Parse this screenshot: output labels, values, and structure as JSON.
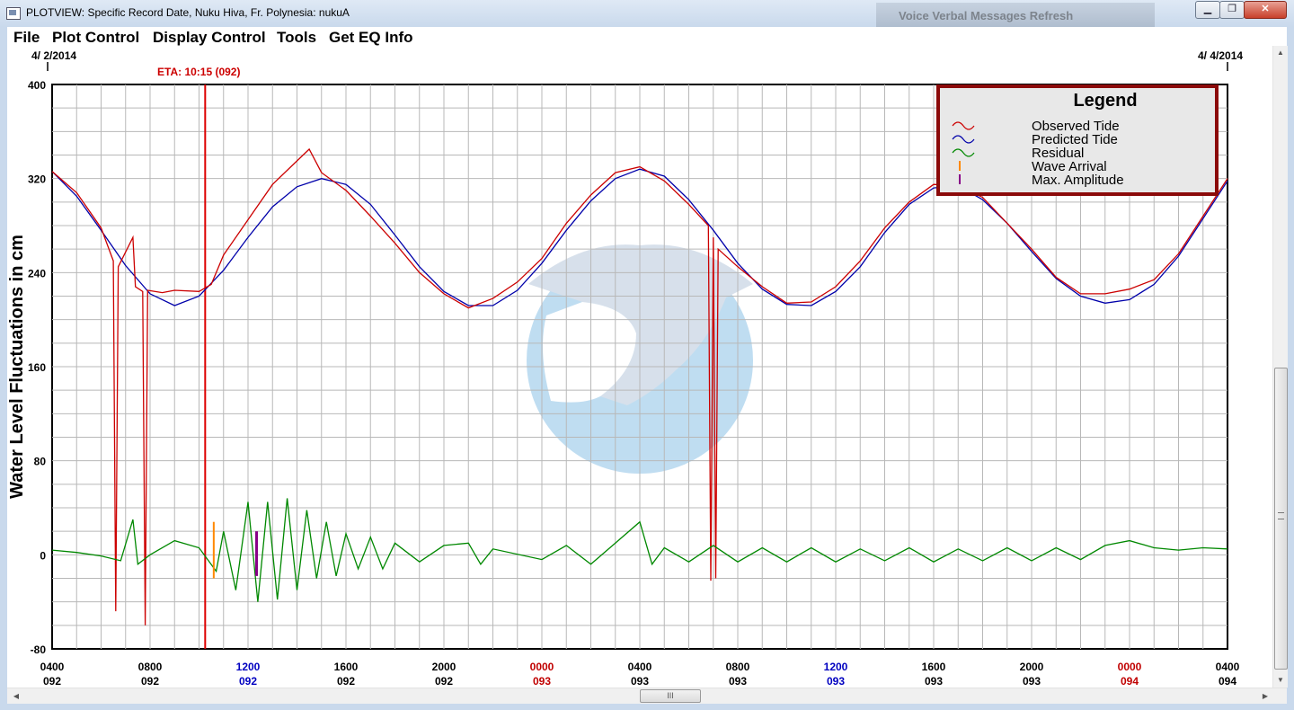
{
  "window": {
    "title": "PLOTVIEW: Specific Record Date, Nuku Hiva, Fr. Polynesia: nukuA",
    "background_window_text": "Voice   Verbal Messages   Refresh",
    "minimize_label": "▁",
    "maximize_label": "❐",
    "close_label": "✕"
  },
  "menu": [
    "File",
    "Plot Control",
    "Display Control",
    "Tools",
    "Get EQ Info"
  ],
  "scrollbars": {
    "up_arrow": "▲",
    "down_arrow": "▼",
    "left_arrow": "◀",
    "right_arrow": "▶",
    "grip": "III"
  },
  "chart_data": {
    "type": "line",
    "ylabel": "Water Level Fluctuations in cm",
    "ylim": [
      -80,
      400
    ],
    "yticks": [
      -80,
      0,
      80,
      160,
      240,
      320,
      400
    ],
    "date_labels": {
      "start": "4/ 2/2014",
      "end": "4/ 4/2014"
    },
    "eta_label": "ETA: 10:15 (092)",
    "eta_time_hours": 10.25,
    "xlim_hours": [
      4,
      52
    ],
    "xticks": [
      {
        "hours": 4,
        "time": "0400",
        "day": "092",
        "color": "#000000"
      },
      {
        "hours": 8,
        "time": "0800",
        "day": "092",
        "color": "#000000"
      },
      {
        "hours": 12,
        "time": "1200",
        "day": "092",
        "color": "#0000c0"
      },
      {
        "hours": 16,
        "time": "1600",
        "day": "092",
        "color": "#000000"
      },
      {
        "hours": 20,
        "time": "2000",
        "day": "092",
        "color": "#000000"
      },
      {
        "hours": 24,
        "time": "0000",
        "day": "093",
        "color": "#c00000"
      },
      {
        "hours": 28,
        "time": "0400",
        "day": "093",
        "color": "#000000"
      },
      {
        "hours": 32,
        "time": "0800",
        "day": "093",
        "color": "#000000"
      },
      {
        "hours": 36,
        "time": "1200",
        "day": "093",
        "color": "#0000c0"
      },
      {
        "hours": 40,
        "time": "1600",
        "day": "093",
        "color": "#000000"
      },
      {
        "hours": 44,
        "time": "2000",
        "day": "093",
        "color": "#000000"
      },
      {
        "hours": 48,
        "time": "0000",
        "day": "094",
        "color": "#c00000"
      },
      {
        "hours": 52,
        "time": "0400",
        "day": "094",
        "color": "#000000"
      }
    ],
    "legend": {
      "title": "Legend",
      "position": "top-right",
      "entries": [
        {
          "label": "Observed Tide",
          "color": "#cc0000",
          "symbol": "wave"
        },
        {
          "label": "Predicted Tide",
          "color": "#0000aa",
          "symbol": "wave"
        },
        {
          "label": "Residual",
          "color": "#008800",
          "symbol": "wave"
        },
        {
          "label": "Wave Arrival",
          "color": "#ff8800",
          "symbol": "tick"
        },
        {
          "label": "Max. Amplitude",
          "color": "#880088",
          "symbol": "tick"
        }
      ]
    },
    "series": [
      {
        "name": "Predicted Tide",
        "color": "#0000aa",
        "points": [
          [
            4,
            326
          ],
          [
            5,
            305
          ],
          [
            6,
            276
          ],
          [
            7,
            246
          ],
          [
            8,
            222
          ],
          [
            9,
            212
          ],
          [
            10,
            220
          ],
          [
            11,
            242
          ],
          [
            12,
            270
          ],
          [
            13,
            296
          ],
          [
            14,
            313
          ],
          [
            15,
            320
          ],
          [
            16,
            315
          ],
          [
            17,
            298
          ],
          [
            18,
            272
          ],
          [
            19,
            245
          ],
          [
            20,
            224
          ],
          [
            21,
            212
          ],
          [
            22,
            212
          ],
          [
            23,
            225
          ],
          [
            24,
            248
          ],
          [
            25,
            276
          ],
          [
            26,
            301
          ],
          [
            27,
            320
          ],
          [
            28,
            328
          ],
          [
            29,
            322
          ],
          [
            30,
            302
          ],
          [
            31,
            276
          ],
          [
            32,
            248
          ],
          [
            33,
            226
          ],
          [
            34,
            213
          ],
          [
            35,
            212
          ],
          [
            36,
            224
          ],
          [
            37,
            245
          ],
          [
            38,
            274
          ],
          [
            39,
            298
          ],
          [
            40,
            312
          ],
          [
            41,
            314
          ],
          [
            42,
            302
          ],
          [
            43,
            282
          ],
          [
            44,
            258
          ],
          [
            45,
            235
          ],
          [
            46,
            220
          ],
          [
            47,
            214
          ],
          [
            48,
            217
          ],
          [
            49,
            230
          ],
          [
            50,
            254
          ],
          [
            51,
            286
          ],
          [
            52,
            318
          ]
        ]
      },
      {
        "name": "Observed Tide",
        "color": "#cc0000",
        "points": [
          [
            4,
            326
          ],
          [
            5,
            308
          ],
          [
            6,
            278
          ],
          [
            6.5,
            250
          ],
          [
            6.6,
            -48
          ],
          [
            6.7,
            245
          ],
          [
            7.3,
            270
          ],
          [
            7.4,
            228
          ],
          [
            7.7,
            224
          ],
          [
            7.8,
            -60
          ],
          [
            7.9,
            225
          ],
          [
            8.5,
            223
          ],
          [
            9,
            225
          ],
          [
            10,
            224
          ],
          [
            10.5,
            230
          ],
          [
            11,
            255
          ],
          [
            12,
            285
          ],
          [
            13,
            315
          ],
          [
            14,
            335
          ],
          [
            14.5,
            345
          ],
          [
            15,
            325
          ],
          [
            16,
            310
          ],
          [
            17,
            288
          ],
          [
            18,
            265
          ],
          [
            19,
            240
          ],
          [
            20,
            222
          ],
          [
            21,
            210
          ],
          [
            22,
            218
          ],
          [
            23,
            232
          ],
          [
            24,
            252
          ],
          [
            25,
            282
          ],
          [
            26,
            306
          ],
          [
            27,
            325
          ],
          [
            28,
            330
          ],
          [
            29,
            318
          ],
          [
            30,
            298
          ],
          [
            30.8,
            280
          ],
          [
            30.9,
            -22
          ],
          [
            31.0,
            270
          ],
          [
            31.1,
            -20
          ],
          [
            31.2,
            260
          ],
          [
            32,
            245
          ],
          [
            33,
            228
          ],
          [
            34,
            214
          ],
          [
            35,
            215
          ],
          [
            36,
            228
          ],
          [
            37,
            250
          ],
          [
            38,
            278
          ],
          [
            39,
            300
          ],
          [
            40,
            315
          ],
          [
            41,
            314
          ],
          [
            42,
            304
          ],
          [
            43,
            282
          ],
          [
            44,
            260
          ],
          [
            45,
            236
          ],
          [
            46,
            222
          ],
          [
            47,
            222
          ],
          [
            48,
            226
          ],
          [
            49,
            234
          ],
          [
            50,
            256
          ],
          [
            51,
            288
          ],
          [
            52,
            320
          ]
        ]
      },
      {
        "name": "Residual",
        "color": "#008800",
        "points": [
          [
            4,
            4
          ],
          [
            5,
            2
          ],
          [
            6,
            -1
          ],
          [
            6.8,
            -5
          ],
          [
            7.3,
            30
          ],
          [
            7.5,
            -8
          ],
          [
            8,
            0
          ],
          [
            9,
            12
          ],
          [
            10,
            6
          ],
          [
            10.7,
            -14
          ],
          [
            11,
            20
          ],
          [
            11.5,
            -30
          ],
          [
            12,
            45
          ],
          [
            12.4,
            -40
          ],
          [
            12.8,
            45
          ],
          [
            13.2,
            -38
          ],
          [
            13.6,
            48
          ],
          [
            14,
            -30
          ],
          [
            14.4,
            38
          ],
          [
            14.8,
            -20
          ],
          [
            15.2,
            28
          ],
          [
            15.6,
            -18
          ],
          [
            16,
            18
          ],
          [
            16.5,
            -12
          ],
          [
            17,
            15
          ],
          [
            17.5,
            -12
          ],
          [
            18,
            10
          ],
          [
            19,
            -6
          ],
          [
            20,
            8
          ],
          [
            21,
            10
          ],
          [
            21.5,
            -8
          ],
          [
            22,
            5
          ],
          [
            24,
            -4
          ],
          [
            25,
            8
          ],
          [
            26,
            -8
          ],
          [
            27,
            10
          ],
          [
            28,
            28
          ],
          [
            28.5,
            -8
          ],
          [
            29,
            6
          ],
          [
            30,
            -6
          ],
          [
            31,
            8
          ],
          [
            32,
            -6
          ],
          [
            33,
            6
          ],
          [
            34,
            -6
          ],
          [
            35,
            6
          ],
          [
            36,
            -6
          ],
          [
            37,
            5
          ],
          [
            38,
            -5
          ],
          [
            39,
            6
          ],
          [
            40,
            -6
          ],
          [
            41,
            5
          ],
          [
            42,
            -5
          ],
          [
            43,
            6
          ],
          [
            44,
            -5
          ],
          [
            45,
            6
          ],
          [
            46,
            -4
          ],
          [
            47,
            8
          ],
          [
            48,
            12
          ],
          [
            49,
            6
          ],
          [
            50,
            4
          ],
          [
            51,
            6
          ],
          [
            52,
            5
          ]
        ]
      }
    ],
    "markers": {
      "wave_arrival_hours": 10.6,
      "max_amplitude_hours": 12.35
    }
  }
}
